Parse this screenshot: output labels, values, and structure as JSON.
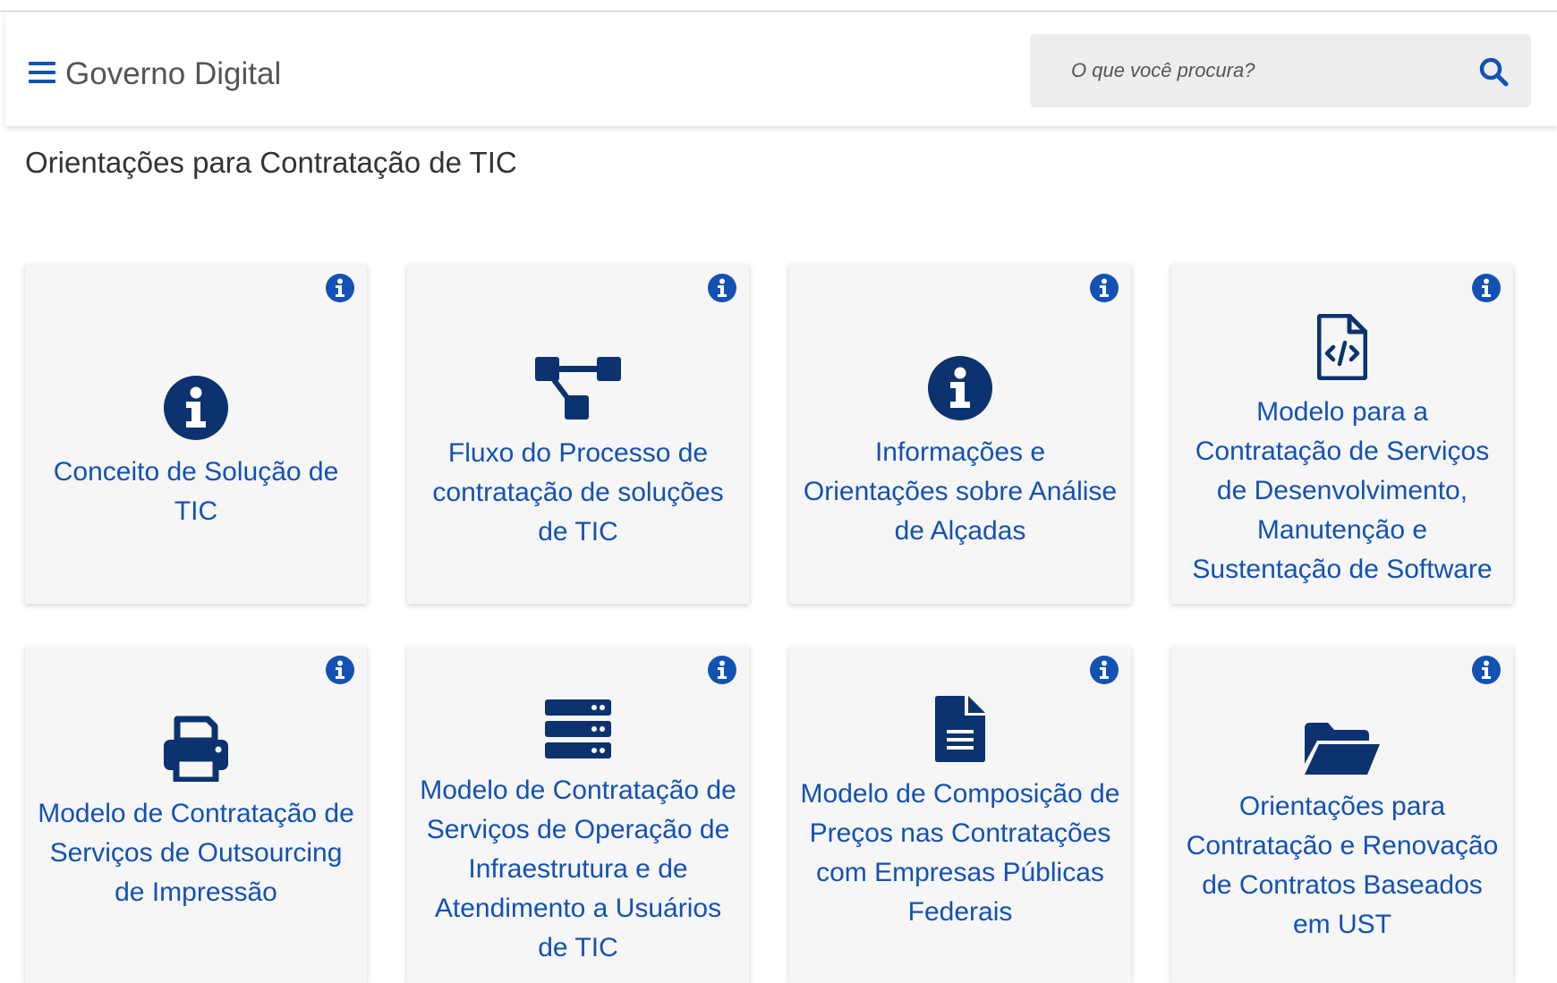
{
  "header": {
    "site_title": "Governo Digital",
    "search_placeholder": "O que você procura?",
    "search_value": ""
  },
  "page": {
    "title": "Orientações para Contratação de TIC"
  },
  "cards": [
    {
      "label": "Conceito de Solução de TIC",
      "icon": "info-circle-icon"
    },
    {
      "label": "Fluxo do Processo de contratação de soluções de TIC",
      "icon": "sitemap-icon"
    },
    {
      "label": "Informações e Orientações sobre Análise de Alçadas",
      "icon": "info-circle-icon"
    },
    {
      "label": "Modelo para a Contratação de Serviços de Desenvolvimento, Manutenção e Sustentação de Software",
      "icon": "file-code-icon"
    },
    {
      "label": "Modelo de Contratação de Serviços de Outsourcing de Impressão",
      "icon": "printer-icon"
    },
    {
      "label": "Modelo de Contratação de Serviços de Operação de Infraestrutura e de Atendimento a Usuários de TIC",
      "icon": "server-icon"
    },
    {
      "label": "Modelo de Composição de Preços nas Contratações com Empresas Públicas Federais",
      "icon": "file-text-icon"
    },
    {
      "label": "Orientações para Contratação e Renovação de Contratos Baseados em UST",
      "icon": "folder-open-icon"
    }
  ],
  "colors": {
    "primary": "#1351b4",
    "icon_dark": "#0c326f",
    "card_bg": "#f6f6f6",
    "search_bg": "#ededed"
  }
}
